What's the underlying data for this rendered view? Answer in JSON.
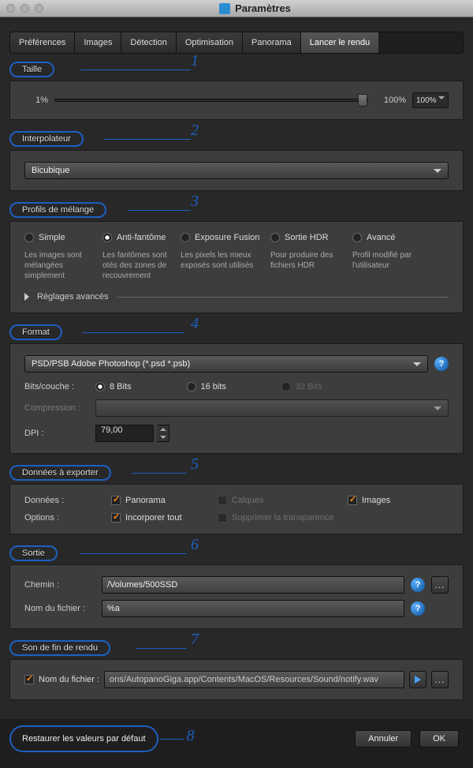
{
  "window": {
    "title": "Paramètres"
  },
  "tabs": [
    "Préférences",
    "Images",
    "Détection",
    "Optimisation",
    "Panorama",
    "Lancer le rendu"
  ],
  "active_tab": 5,
  "callouts": [
    "1",
    "2",
    "3",
    "4",
    "5",
    "6",
    "7",
    "8"
  ],
  "section_taille": {
    "label": "Taille",
    "pct_min": "1%",
    "pct_max": "100%",
    "value": "100%"
  },
  "section_interp": {
    "label": "Interpolateur",
    "selected": "Bicubique"
  },
  "section_blend": {
    "label": "Profils de mélange",
    "options": [
      {
        "name": "Simple",
        "desc": "Les images sont mélangées simplement"
      },
      {
        "name": "Anti-fantôme",
        "desc": "Les fantômes sont otés des zones de recouvrement"
      },
      {
        "name": "Exposure Fusion",
        "desc": "Les pixels les mieux exposés sont utilisés"
      },
      {
        "name": "Sortie HDR",
        "desc": "Pour produire des fichiers HDR"
      },
      {
        "name": "Avancé",
        "desc": "Profil modifié par l'utilisateur"
      }
    ],
    "selected_index": 1,
    "advanced": "Réglages avancés"
  },
  "section_format": {
    "label": "Format",
    "selected": "PSD/PSB Adobe Photoshop (*.psd *.psb)",
    "bits_label": "Bits/couche :",
    "bits_options": [
      "8 Bits",
      "16 bits",
      "32 Bits"
    ],
    "bits_selected": 0,
    "compression_label": "Compression :",
    "compression_value": "",
    "dpi_label": "DPI :",
    "dpi_value": "79,00"
  },
  "section_export": {
    "label": "Données à exporter",
    "data_label": "Données :",
    "options_label": "Options :",
    "panorama": "Panorama",
    "calques": "Calques",
    "images": "Images",
    "incorporer": "Incorporer tout",
    "supprimer": "Supprimer la transparence"
  },
  "section_output": {
    "label": "Sortie",
    "path_label": "Chemin :",
    "path_value": "/Volumes/500SSD",
    "filename_label": "Nom du fichier :",
    "filename_value": "%a"
  },
  "section_sound": {
    "label": "Son de fin de rendu",
    "filename_label": "Nom du fichier :",
    "filename_value": "ons/AutopanoGiga.app/Contents/MacOS/Resources/Sound/notify.wav"
  },
  "buttons": {
    "restore": "Restaurer les valeurs par défaut",
    "cancel": "Annuler",
    "ok": "OK"
  }
}
